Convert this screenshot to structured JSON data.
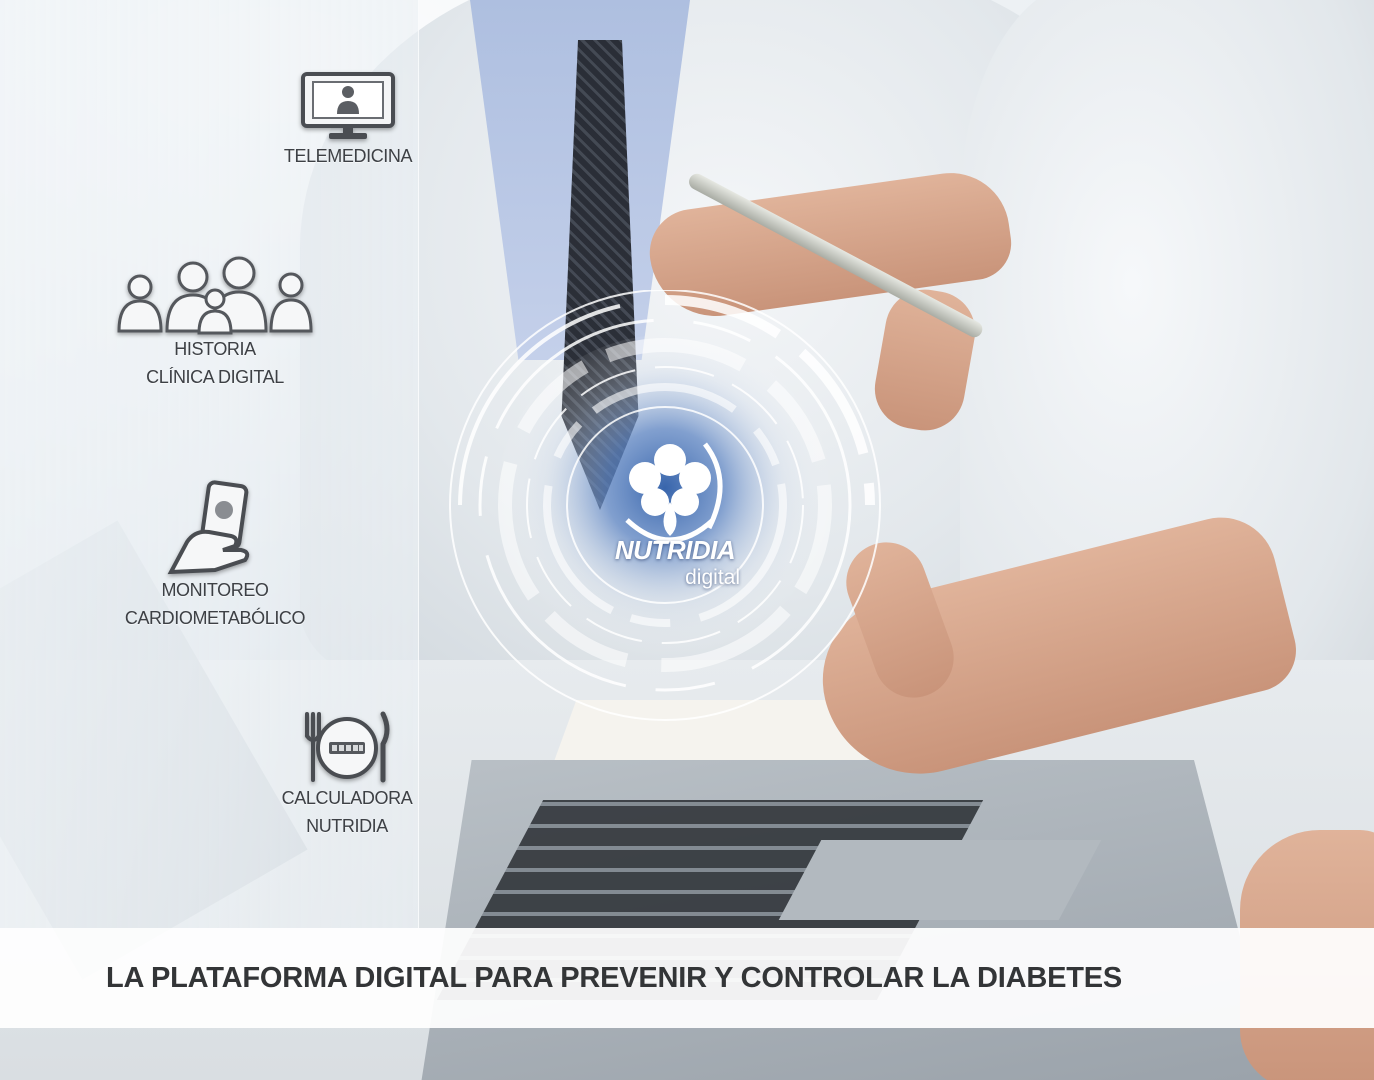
{
  "features": [
    {
      "lines": [
        "TELEMEDICINA"
      ],
      "icon": "telemedicine-monitor-icon"
    },
    {
      "lines": [
        "HISTORIA",
        "CLÍNICA DIGITAL"
      ],
      "icon": "patients-group-icon"
    },
    {
      "lines": [
        "MONITOREO",
        "CARDIOMETABÓLICO"
      ],
      "icon": "hand-phone-icon"
    },
    {
      "lines": [
        "CALCULADORA",
        "NUTRIDIA"
      ],
      "icon": "plate-cutlery-icon"
    }
  ],
  "logo": {
    "name": "NUTRIDIA",
    "sub": "digital",
    "icon": "nutridia-flower-icon",
    "accent": "#2f5ea8"
  },
  "banner": {
    "tagline": "LA PLATAFORMA DIGITAL PARA PREVENIR Y CONTROLAR LA DIABETES"
  },
  "colors": {
    "text_dark": "#333537",
    "label": "#3d4045",
    "banner_bg": "#ffffff"
  }
}
